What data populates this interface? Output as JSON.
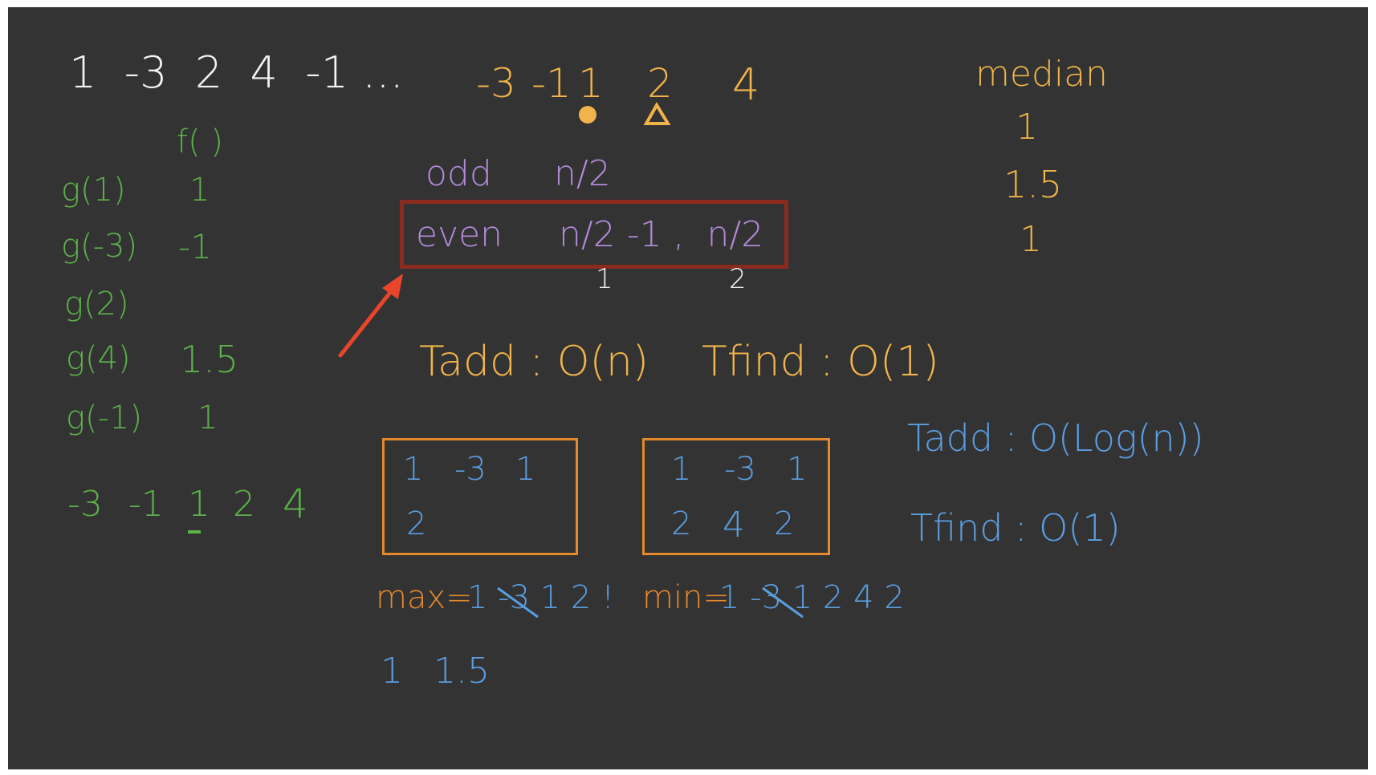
{
  "sequence": "1  -3  2  4  -1 ...",
  "sorted_row": [
    "-3",
    "-1",
    "1",
    "2",
    "4"
  ],
  "median": {
    "label": "median",
    "values": [
      "1",
      "1.5",
      "1"
    ]
  },
  "f_label": "f( )",
  "g_rows": [
    {
      "call": "g(1)",
      "value": "1"
    },
    {
      "call": "g(-3)",
      "value": "-1"
    },
    {
      "call": "g(2)",
      "value": ""
    },
    {
      "call": "g(4)",
      "value": "1.5"
    },
    {
      "call": "g(-1)",
      "value": "1"
    }
  ],
  "green_sorted": [
    "-3",
    "-1",
    "1",
    "2",
    "4"
  ],
  "odd": {
    "label": "odd",
    "formula": "n/2"
  },
  "even": {
    "label": "even",
    "formula": "n/2 -1 ,  n/2",
    "under_left": "1",
    "under_right": "2"
  },
  "naive": {
    "tadd": "Tadd : O(n)",
    "tfind": "Tfind : O(1)"
  },
  "heap": {
    "tadd": "Tadd : O(Log(n))",
    "tfind": "Tfind : O(1)"
  },
  "left_box": {
    "row1": [
      "1",
      "-3",
      "1"
    ],
    "row2": [
      "2"
    ]
  },
  "right_box": {
    "row1": [
      "1",
      "-3",
      "1"
    ],
    "row2": [
      "2",
      "4",
      "2"
    ]
  },
  "max_label": "max=",
  "max_seq": "1 -3 1 2 !",
  "min_label": "min=",
  "min_seq": "1 -3 1 2 4 2",
  "bottom_values": [
    "1",
    "1.5"
  ],
  "colors": {
    "board": "#333333",
    "white": "#f4f4f4",
    "yellow": "#f0b44a",
    "green": "#5cb24a",
    "purple": "#b38ad8",
    "blue": "#5b9ee0",
    "orange": "#e4892c",
    "highlight_box": "#8b2a1f",
    "arrow": "#e8452a"
  }
}
